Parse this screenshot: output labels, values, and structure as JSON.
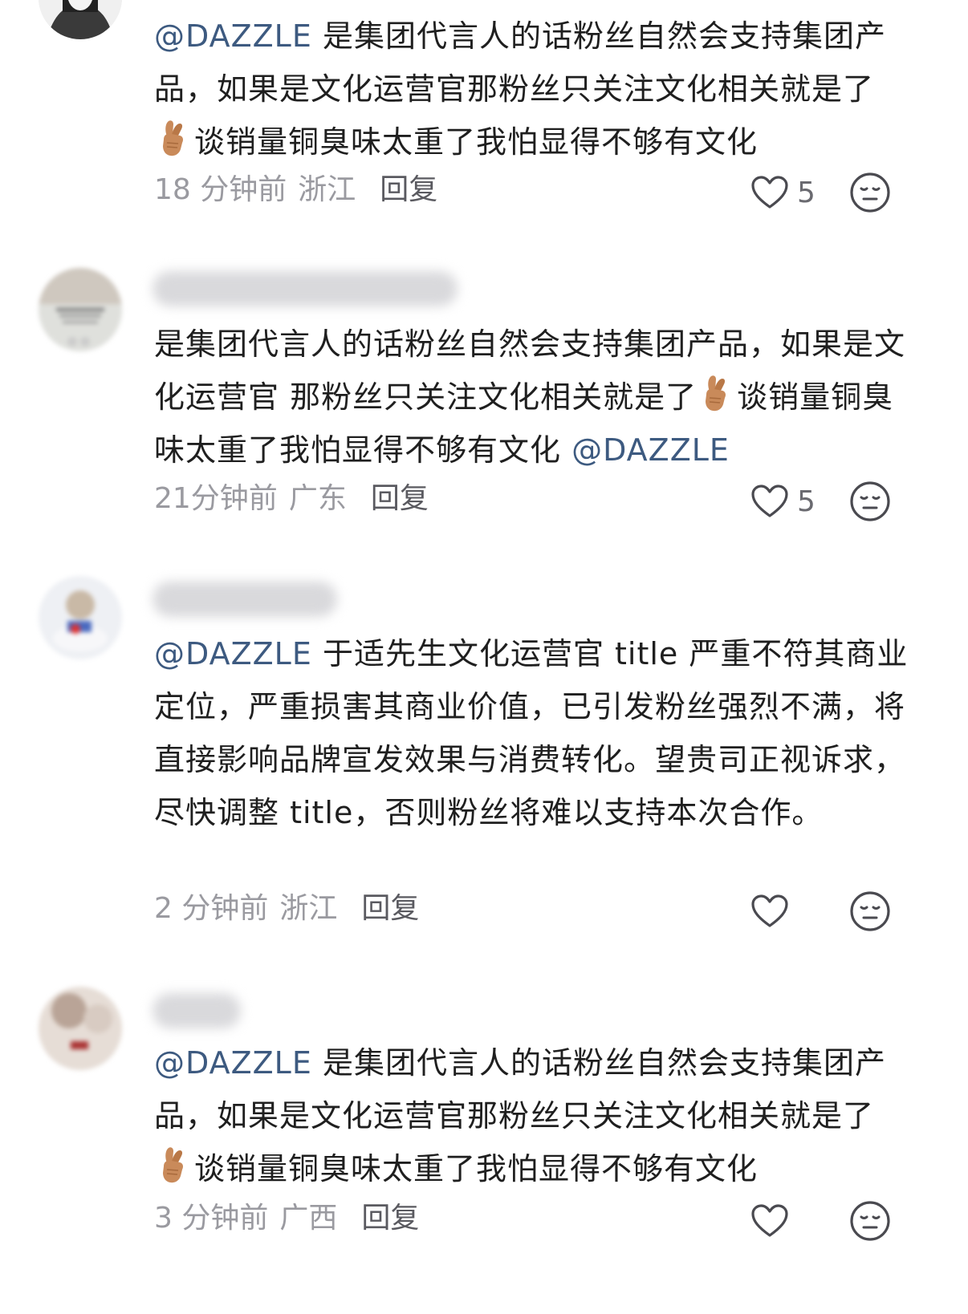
{
  "comments": [
    {
      "mention": "@DAZZLE",
      "text_before": "是集团代言人的话粉丝自然会支持集团产品，如果是文化运营官那粉丝只关注文化相关就是了",
      "text_after": "谈销量铜臭味太重了我怕显得不够有文化",
      "time": "18 分钟前",
      "location": "浙江",
      "reply": "回复",
      "likes": "5"
    },
    {
      "text_before": "是集团代言人的话粉丝自然会支持集团产品，如果是文化运营官 那粉丝只关注文化相关就是了",
      "text_after": "谈销量铜臭味太重了我怕显得不够有文化 ",
      "mention": "@DAZZLE",
      "time": "21分钟前",
      "location": "广东",
      "reply": "回复",
      "likes": "5"
    },
    {
      "mention": "@DAZZLE",
      "text": "于适先生文化运营官 title  严重不符其商业定位，严重损害其商业价值，已引发粉丝强烈不满，将直接影响品牌宣发效果与消费转化。望贵司正视诉求，尽快调整 title，否则粉丝将难以支持本次合作。",
      "time": "2 分钟前",
      "location": "浙江",
      "reply": "回复"
    },
    {
      "mention": "@DAZZLE",
      "text_before": "是集团代言人的话粉丝自然会支持集团产品，如果是文化运营官那粉丝只关注文化相关就是了",
      "text_after": "谈销量铜臭味太重了我怕显得不够有文化",
      "time": "3 分钟前",
      "location": "广西",
      "reply": "回复"
    }
  ],
  "icons": {
    "emoji": "crossed-fingers-emoji",
    "like": "heart-outline-icon",
    "reaction": "neutral-face-icon"
  },
  "colors": {
    "mention": "#3d5a80",
    "meta": "#9a9aa0",
    "text": "#1f1f1f"
  }
}
